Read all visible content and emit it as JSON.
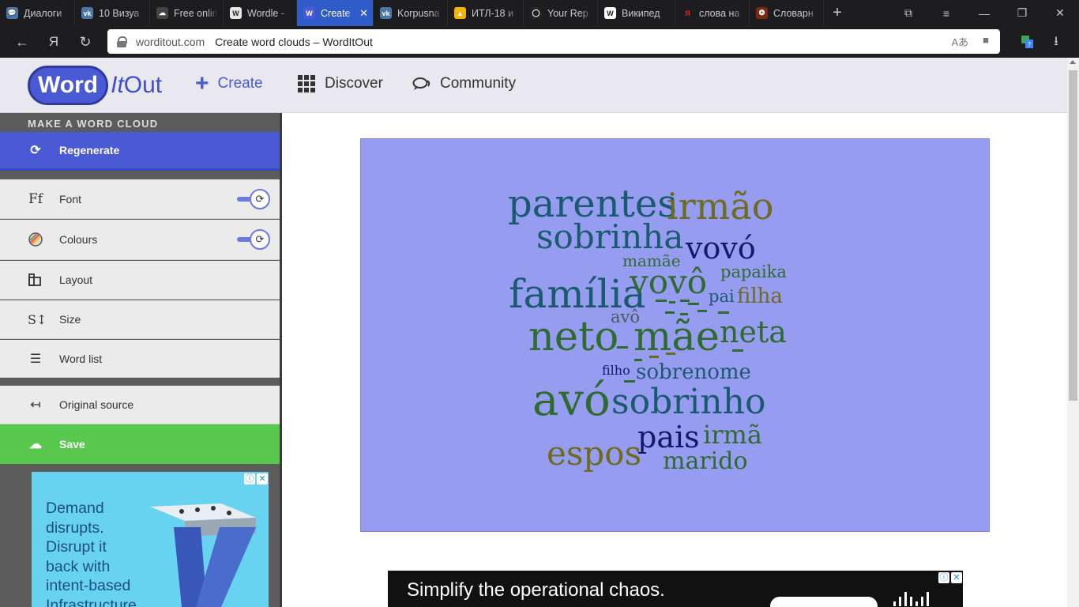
{
  "browser": {
    "tabs": [
      {
        "title": "Диалоги",
        "color": "#4a76a8",
        "glyph": "💬"
      },
      {
        "title": "10 Визуа",
        "color": "#4a76a8",
        "glyph": "vk"
      },
      {
        "title": "Free onlin",
        "color": "#444",
        "glyph": "☁"
      },
      {
        "title": "Wordle -",
        "color": "#e8e8e8",
        "glyph": "W"
      },
      {
        "title": "Create",
        "color": "#4a59d4",
        "glyph": "W",
        "active": true
      },
      {
        "title": "Korpusna",
        "color": "#4a76a8",
        "glyph": "vk"
      },
      {
        "title": "ИТЛ-18 и",
        "color": "#f4b400",
        "glyph": "▲"
      },
      {
        "title": "Your Rep",
        "color": "#222",
        "glyph": "◯"
      },
      {
        "title": "Википед",
        "color": "#fff",
        "glyph": "W"
      },
      {
        "title": "слова на",
        "color": "#1d1d20",
        "glyph": "Я"
      },
      {
        "title": "Словарн",
        "color": "#7a2a10",
        "glyph": "❂"
      }
    ],
    "url_domain": "worditout.com",
    "page_title": "Create word clouds – WordItOut"
  },
  "header": {
    "logo_word": "Word",
    "logo_it": "It",
    "logo_out": "Out",
    "nav_create": "Create",
    "nav_discover": "Discover",
    "nav_community": "Community"
  },
  "sidebar": {
    "heading": "MAKE A WORD CLOUD",
    "regenerate": "Regenerate",
    "font": "Font",
    "colours": "Colours",
    "layout": "Layout",
    "size": "Size",
    "word_list": "Word list",
    "original_source": "Original source",
    "save": "Save"
  },
  "ad_left": {
    "text": "Demand\ndisrupts.\nDisrupt it\nback with\nintent-based\nInfrastructure"
  },
  "ad_bottom": {
    "text": "Simplify the operational chaos."
  },
  "cloud": {
    "background": "#969cf0",
    "words": [
      {
        "text": "parentes",
        "color": "#1a5a6e"
      },
      {
        "text": "irmão",
        "color": "#6e6a1e"
      },
      {
        "text": "sobrinha",
        "color": "#1a5a6e"
      },
      {
        "text": "vovó",
        "color": "#15186a"
      },
      {
        "text": "mamãe",
        "color": "#2f6a30"
      },
      {
        "text": "família",
        "color": "#1a5a6e"
      },
      {
        "text": "vovô",
        "color": "#2f6a30"
      },
      {
        "text": "papaika",
        "color": "#2f6a30"
      },
      {
        "text": "pai",
        "color": "#1a5a6e"
      },
      {
        "text": "filha",
        "color": "#6e6a1e"
      },
      {
        "text": "avô",
        "color": "#4a5a5a"
      },
      {
        "text": "neto",
        "color": "#2f6a30"
      },
      {
        "text": "mãe",
        "color": "#2f6a30"
      },
      {
        "text": "neta",
        "color": "#2f6a30"
      },
      {
        "text": "filho",
        "color": "#15186a"
      },
      {
        "text": "sobrenome",
        "color": "#1a5a6e"
      },
      {
        "text": "avó",
        "color": "#2f6a30"
      },
      {
        "text": "sobrinho",
        "color": "#1a5a6e"
      },
      {
        "text": "pais",
        "color": "#15186a"
      },
      {
        "text": "irmã",
        "color": "#2f6a30"
      },
      {
        "text": "espos",
        "color": "#6e6a1e"
      },
      {
        "text": "marido",
        "color": "#2f6a30"
      }
    ]
  }
}
